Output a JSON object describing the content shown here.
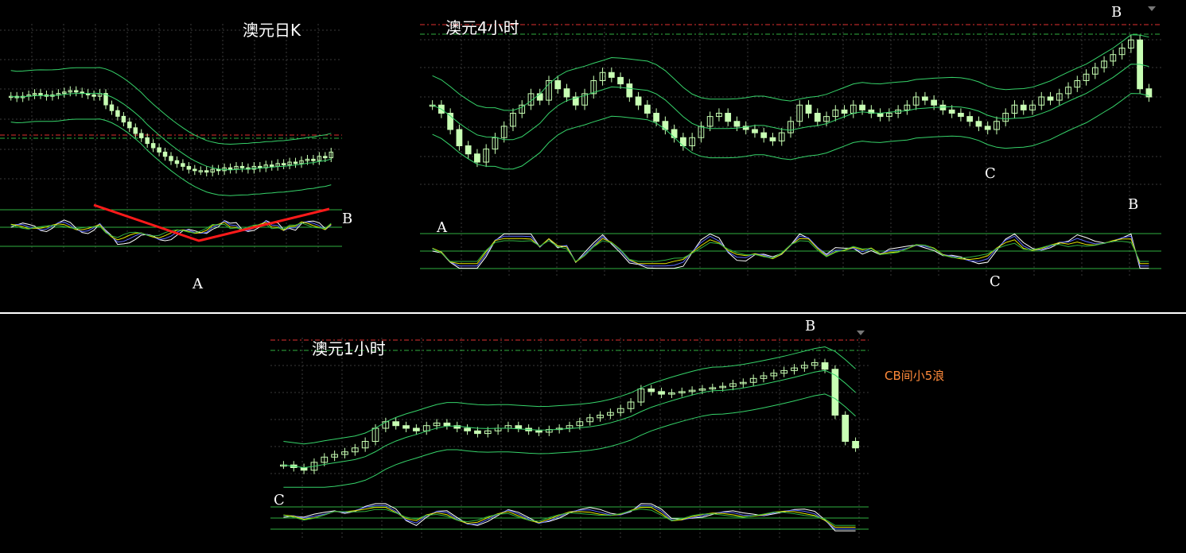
{
  "panels": [
    {
      "id": "daily",
      "title": "澳元日K",
      "labels": {
        "A": "A",
        "B": "B"
      }
    },
    {
      "id": "h4",
      "title": "澳元4小时",
      "labels": {
        "A": "A",
        "B": "B",
        "C": "C",
        "C2": "C",
        "B2": "B"
      }
    },
    {
      "id": "h1",
      "title": "澳元1小时",
      "labels": {
        "B": "B",
        "C": "C"
      },
      "note": "CB间小5浪"
    }
  ],
  "colors": {
    "background": "#000000",
    "candle": "#c8ffb4",
    "band": "#36d36a",
    "grid": "#3a3a3a",
    "red_level": "#e03030",
    "green_level": "#2fb040",
    "trend_line": "#ff1a1a",
    "osc_lines": [
      "#ffffff",
      "#5f6bff",
      "#e6e600",
      "#2fb040"
    ]
  },
  "chart_data": [
    {
      "type": "candlestick",
      "title": "澳元日K",
      "closes": [
        0.66,
        0.65,
        0.66,
        0.67,
        0.68,
        0.67,
        0.66,
        0.67,
        0.68,
        0.69,
        0.7,
        0.69,
        0.68,
        0.67,
        0.66,
        0.68,
        0.6,
        0.56,
        0.52,
        0.48,
        0.44,
        0.4,
        0.37,
        0.33,
        0.3,
        0.27,
        0.24,
        0.21,
        0.19,
        0.17,
        0.15,
        0.14,
        0.14,
        0.13,
        0.15,
        0.14,
        0.16,
        0.15,
        0.17,
        0.16,
        0.15,
        0.17,
        0.16,
        0.18,
        0.17,
        0.19,
        0.18,
        0.2,
        0.19,
        0.21,
        0.22,
        0.21,
        0.24,
        0.23,
        0.27
      ],
      "annotations": [
        "A",
        "B"
      ]
    },
    {
      "type": "candlestick",
      "title": "澳元4小时",
      "closes": [
        0.55,
        0.5,
        0.4,
        0.3,
        0.25,
        0.2,
        0.28,
        0.35,
        0.42,
        0.5,
        0.55,
        0.62,
        0.58,
        0.7,
        0.65,
        0.6,
        0.55,
        0.62,
        0.7,
        0.75,
        0.72,
        0.68,
        0.6,
        0.55,
        0.5,
        0.45,
        0.4,
        0.35,
        0.3,
        0.35,
        0.42,
        0.48,
        0.5,
        0.45,
        0.42,
        0.4,
        0.38,
        0.35,
        0.33,
        0.38,
        0.45,
        0.55,
        0.5,
        0.45,
        0.48,
        0.52,
        0.5,
        0.55,
        0.52,
        0.5,
        0.48,
        0.5,
        0.52,
        0.55,
        0.6,
        0.58,
        0.55,
        0.52,
        0.5,
        0.48,
        0.45,
        0.42,
        0.4,
        0.45,
        0.5,
        0.55,
        0.52,
        0.55,
        0.6,
        0.58,
        0.62,
        0.66,
        0.7,
        0.74,
        0.78,
        0.82,
        0.86,
        0.9,
        0.95,
        0.65,
        0.6
      ],
      "annotations": [
        "A",
        "B",
        "C"
      ]
    },
    {
      "type": "candlestick",
      "title": "澳元1小时",
      "closes": [
        0.12,
        0.1,
        0.08,
        0.14,
        0.18,
        0.2,
        0.22,
        0.25,
        0.3,
        0.4,
        0.45,
        0.42,
        0.4,
        0.38,
        0.42,
        0.44,
        0.42,
        0.4,
        0.38,
        0.36,
        0.38,
        0.4,
        0.42,
        0.4,
        0.38,
        0.37,
        0.39,
        0.4,
        0.42,
        0.45,
        0.48,
        0.5,
        0.52,
        0.55,
        0.6,
        0.7,
        0.68,
        0.66,
        0.67,
        0.68,
        0.69,
        0.7,
        0.71,
        0.72,
        0.74,
        0.75,
        0.78,
        0.8,
        0.82,
        0.84,
        0.86,
        0.88,
        0.9,
        0.85,
        0.5,
        0.3,
        0.25
      ],
      "annotations": [
        "B",
        "C"
      ]
    }
  ]
}
